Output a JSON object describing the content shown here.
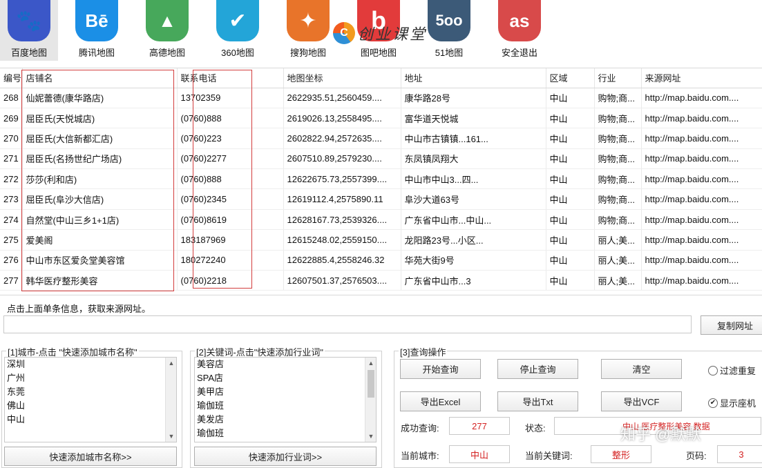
{
  "toolbar": {
    "items": [
      {
        "label": "百度地图",
        "glyph": "🐾",
        "color": "#3b57c8",
        "icon": "baidu-paw-icon"
      },
      {
        "label": "腾讯地图",
        "glyph": "Bē",
        "color": "#1b8fe6",
        "icon": "tencent-map-icon"
      },
      {
        "label": "高德地图",
        "glyph": "▲",
        "color": "#47a85b",
        "icon": "gaode-map-icon"
      },
      {
        "label": "360地图",
        "glyph": "✔",
        "color": "#23a5d8",
        "icon": "map360-icon"
      },
      {
        "label": "搜狗地图",
        "glyph": "✦",
        "color": "#e8742a",
        "icon": "sogou-map-icon"
      },
      {
        "label": "图吧地图",
        "glyph": "b",
        "color": "#e23b3b",
        "icon": "tuba-map-icon"
      },
      {
        "label": "51地图",
        "glyph": "5oo",
        "color": "#3c5a78",
        "icon": "map51-icon"
      },
      {
        "label": "安全退出",
        "glyph": "as",
        "color": "#d84a4a",
        "icon": "exit-icon"
      }
    ],
    "brand": {
      "text": "创业课堂",
      "mark": "C"
    }
  },
  "table": {
    "columns": [
      "编号",
      "店铺名",
      "联系电话",
      "地图坐标",
      "地址",
      "区域",
      "行业",
      "来源网址"
    ],
    "rows": [
      [
        "268",
        "仙妮蕾德(康华路店)",
        "13702359",
        "2622935.51,2560459....",
        "康华路28号",
        "中山",
        "购物;商...",
        "http://map.baidu.com...."
      ],
      [
        "269",
        "屈臣氏(天悦城店)",
        "(0760)888",
        "2619026.13,2558495....",
        "富华道天悦城",
        "中山",
        "购物;商...",
        "http://map.baidu.com...."
      ],
      [
        "270",
        "屈臣氏(大信新都汇店)",
        "(0760)223",
        "2602822.94,2572635....",
        "中山市古镇镇...161...",
        "中山",
        "购物;商...",
        "http://map.baidu.com...."
      ],
      [
        "271",
        "屈臣氏(名扬世纪广场店)",
        "(0760)2277",
        "2607510.89,2579230....",
        "东凤镇凤翔大",
        "中山",
        "购物;商...",
        "http://map.baidu.com...."
      ],
      [
        "272",
        "莎莎(利和店)",
        "(0760)888",
        "12622675.73,2557399....",
        "中山市中山3...四...",
        "中山",
        "购物;商...",
        "http://map.baidu.com...."
      ],
      [
        "273",
        "屈臣氏(阜沙大信店)",
        "(0760)2345",
        "12619112.4,2575890.11",
        "阜沙大道63号",
        "中山",
        "购物;商...",
        "http://map.baidu.com...."
      ],
      [
        "274",
        "自然堂(中山三乡1+1店)",
        "(0760)8619",
        "12628167.73,2539326....",
        "广东省中山市...中山...",
        "中山",
        "购物;商...",
        "http://map.baidu.com...."
      ],
      [
        "275",
        "爱美阁",
        "183187969",
        "12615248.02,2559150....",
        "龙阳路23号...小区...",
        "中山",
        "丽人;美...",
        "http://map.baidu.com...."
      ],
      [
        "276",
        "中山市东区爱灸堂美容馆",
        "180272240",
        "12622885.4,2558246.32",
        "华苑大街9号",
        "中山",
        "丽人;美...",
        "http://map.baidu.com...."
      ],
      [
        "277",
        "韩华医疗整形美容",
        "(0760)2218",
        "12607501.37,2576503....",
        "广东省中山市...3",
        "中山",
        "丽人;美...",
        "http://map.baidu.com...."
      ]
    ]
  },
  "info": {
    "hint": "点击上面单条信息，获取来源网址。",
    "url_value": "",
    "copy_label": "复制网址"
  },
  "city_panel": {
    "title": "[1]城市-点击 \"快速添加城市名称\"",
    "items": [
      "深圳",
      "广州",
      "东莞",
      "佛山",
      "中山"
    ],
    "button": "快速添加城市名称>>"
  },
  "keyword_panel": {
    "title": "[2]关键词-点击\"快速添加行业词\"",
    "items": [
      "美容店",
      "SPA店",
      "美甲店",
      "瑜伽班",
      "美发店",
      "瑜伽班"
    ],
    "button": "快速添加行业词>>"
  },
  "query_panel": {
    "title": "[3]查询操作",
    "start": "开始查询",
    "stop": "停止查询",
    "clear": "清空",
    "export_excel": "导出Excel",
    "export_txt": "导出Txt",
    "export_vcf": "导出VCF",
    "filter_dup": "过滤重复",
    "show_phone": "显示座机",
    "success_label": "成功查询:",
    "success_value": "277",
    "status_label": "状态:",
    "status_value": "中山 医疗整形美容 数据",
    "city_label": "当前城市:",
    "city_value": "中山",
    "keyword_label": "当前关键词:",
    "keyword_value": "整形",
    "page_label": "页码:",
    "page_value": "3"
  },
  "watermark": "知乎 @默默"
}
